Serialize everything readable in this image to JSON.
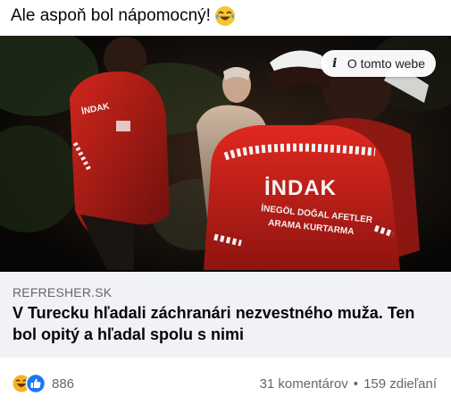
{
  "post": {
    "caption": "Ale aspoň bol nápomocný!",
    "caption_emoji": "face-with-tears-of-joy-icon"
  },
  "link_card": {
    "about_label": "O tomto webe",
    "domain": "REFRESHER.SK",
    "title": "V Turecku hľadali záchranári nezvestného muža. Ten bol opitý a hľadal spolu s nimi",
    "image": {
      "vest_text_main": "İNDAK",
      "vest_text_line1": "İNEGÖL DOĞAL AFETLER",
      "vest_text_line2": "ARAMA KURTARMA",
      "side_vest_text": "İNDAK",
      "colors": {
        "night": "#0c0a08",
        "vest_red": "#c8201a",
        "stripe": "#f2f2f2"
      }
    }
  },
  "footer": {
    "reaction_icons": [
      "haha-reaction-icon",
      "like-reaction-icon"
    ],
    "reaction_count": "886",
    "comments": "31 komentárov",
    "separator": "•",
    "shares": "159 zdieľaní"
  },
  "colors": {
    "secondary_text": "#65676b",
    "link_meta_bg": "#f0f2f5",
    "like_blue": "#1877f2",
    "haha_yellow": "#f7b125"
  }
}
